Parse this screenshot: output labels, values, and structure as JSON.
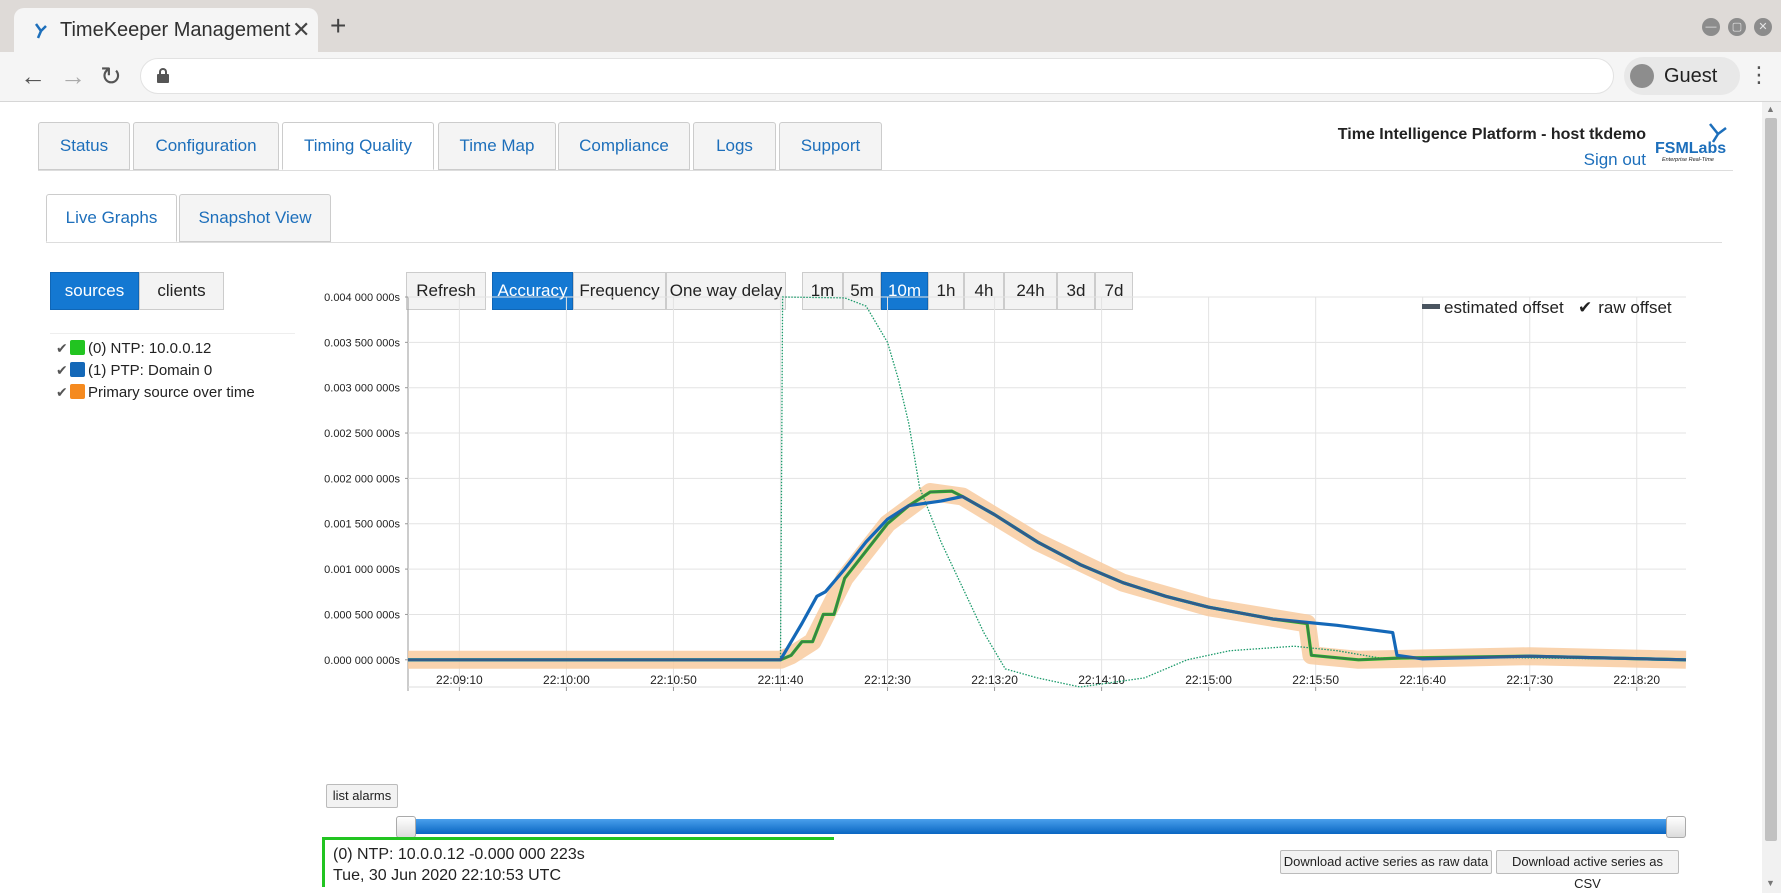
{
  "browser": {
    "tab_title": "TimeKeeper Management",
    "tab_close": "✕",
    "new_tab": "+",
    "profile_label": "Guest"
  },
  "header": {
    "platform_title": "Time Intelligence Platform - host tkdemo",
    "sign_out": "Sign out",
    "logo_text": "FSMLabs",
    "logo_tagline": "Enterprise Real-Time"
  },
  "main_tabs": [
    {
      "label": "Status"
    },
    {
      "label": "Configuration"
    },
    {
      "label": "Timing Quality",
      "active": true
    },
    {
      "label": "Time Map"
    },
    {
      "label": "Compliance"
    },
    {
      "label": "Logs"
    },
    {
      "label": "Support"
    }
  ],
  "sub_tabs": [
    {
      "label": "Live Graphs",
      "active": true
    },
    {
      "label": "Snapshot View"
    }
  ],
  "view_toggle": {
    "sources": "sources",
    "clients": "clients",
    "selected": "sources"
  },
  "controls": {
    "refresh": "Refresh",
    "metrics": [
      "Accuracy",
      "Frequency",
      "One way delay"
    ],
    "selected_metric": "Accuracy",
    "ranges": [
      "1m",
      "5m",
      "10m",
      "1h",
      "4h",
      "24h",
      "3d",
      "7d"
    ],
    "selected_range": "10m"
  },
  "sources_legend": [
    {
      "label": "(0) NTP: 10.0.0.12",
      "color": "#22c421",
      "checked": true
    },
    {
      "label": "(1) PTP: Domain 0",
      "color": "#1468b8",
      "checked": true
    },
    {
      "label": "Primary source over time",
      "color": "#f58a1f",
      "checked": true
    }
  ],
  "series_legend": {
    "estimated": "estimated offset",
    "raw": "raw offset"
  },
  "chart_data": {
    "type": "line",
    "title": "",
    "xlabel": "",
    "ylabel": "",
    "x_ticks": [
      "22:09:10",
      "22:10:00",
      "22:10:50",
      "22:11:40",
      "22:12:30",
      "22:13:20",
      "22:14:10",
      "22:15:00",
      "22:15:50",
      "22:16:40",
      "22:17:30",
      "22:18:20"
    ],
    "y_ticks": [
      "0.000 000 000s",
      "0.000 500 000s",
      "0.001 000 000s",
      "0.001 500 000s",
      "0.002 000 000s",
      "0.002 500 000s",
      "0.003 000 000s",
      "0.003 500 000s",
      "0.004 000 000s"
    ],
    "xlim": [
      "22:08:46",
      "22:18:43"
    ],
    "ylim": [
      -0.0003,
      0.004
    ],
    "grid": true,
    "legend": "top-right",
    "series": [
      {
        "name": "(0) NTP: 10.0.0.12 estimated offset",
        "color": "#22c421",
        "style": "thick",
        "points": [
          [
            "22:08:46",
            0.0
          ],
          [
            "22:11:40",
            0.0
          ],
          [
            "22:11:45",
            5e-05
          ],
          [
            "22:11:50",
            0.0002
          ],
          [
            "22:11:55",
            0.0002
          ],
          [
            "22:12:00",
            0.0005
          ],
          [
            "22:12:05",
            0.0005
          ],
          [
            "22:12:10",
            0.0009
          ],
          [
            "22:12:20",
            0.0012
          ],
          [
            "22:12:30",
            0.0015
          ],
          [
            "22:12:40",
            0.0017
          ],
          [
            "22:12:50",
            0.00185
          ],
          [
            "22:13:00",
            0.00186
          ],
          [
            "22:13:05",
            0.0018
          ],
          [
            "22:13:20",
            0.0016
          ],
          [
            "22:13:40",
            0.0013
          ],
          [
            "22:14:00",
            0.00105
          ],
          [
            "22:14:20",
            0.00085
          ],
          [
            "22:14:40",
            0.0007
          ],
          [
            "22:15:00",
            0.00058
          ],
          [
            "22:15:30",
            0.00045
          ],
          [
            "22:15:46",
            0.0004
          ],
          [
            "22:15:48",
            5e-05
          ],
          [
            "22:16:10",
            0.0
          ],
          [
            "22:16:30",
            2e-05
          ],
          [
            "22:17:30",
            4e-05
          ],
          [
            "22:18:43",
            0.0
          ]
        ]
      },
      {
        "name": "(1) PTP: Domain 0 estimated offset",
        "color": "#1468b8",
        "style": "thick",
        "points": [
          [
            "22:08:46",
            0.0
          ],
          [
            "22:11:40",
            0.0
          ],
          [
            "22:11:50",
            0.0004
          ],
          [
            "22:11:57",
            0.0007
          ],
          [
            "22:12:01",
            0.00075
          ],
          [
            "22:12:10",
            0.001
          ],
          [
            "22:12:20",
            0.0013
          ],
          [
            "22:12:30",
            0.00155
          ],
          [
            "22:12:40",
            0.0017
          ],
          [
            "22:12:55",
            0.00175
          ],
          [
            "22:13:05",
            0.0018
          ],
          [
            "22:13:20",
            0.0016
          ],
          [
            "22:13:40",
            0.0013
          ],
          [
            "22:14:00",
            0.00105
          ],
          [
            "22:14:20",
            0.00085
          ],
          [
            "22:14:40",
            0.0007
          ],
          [
            "22:15:00",
            0.00058
          ],
          [
            "22:15:30",
            0.00045
          ],
          [
            "22:16:00",
            0.00038
          ],
          [
            "22:16:26",
            0.0003
          ],
          [
            "22:16:28",
            5e-05
          ],
          [
            "22:16:40",
            1e-05
          ],
          [
            "22:17:30",
            4e-05
          ],
          [
            "22:18:43",
            0.0
          ]
        ]
      },
      {
        "name": "raw offset",
        "color": "#1a9a6a",
        "style": "dotted",
        "points": [
          [
            "22:08:46",
            0.0
          ],
          [
            "22:11:40",
            0.0
          ],
          [
            "22:11:41",
            0.004
          ],
          [
            "22:12:10",
            0.00399
          ],
          [
            "22:12:20",
            0.0039
          ],
          [
            "22:12:30",
            0.0035
          ],
          [
            "22:12:35",
            0.0031
          ],
          [
            "22:12:40",
            0.0026
          ],
          [
            "22:12:45",
            0.0019
          ],
          [
            "22:12:55",
            0.0013
          ],
          [
            "22:13:05",
            0.0008
          ],
          [
            "22:13:15",
            0.0003
          ],
          [
            "22:13:25",
            -0.0001
          ],
          [
            "22:13:40",
            -0.0002
          ],
          [
            "22:14:00",
            -0.0003
          ],
          [
            "22:14:30",
            -0.0002
          ],
          [
            "22:14:50",
            0.0
          ],
          [
            "22:15:10",
            0.0001
          ],
          [
            "22:15:40",
            0.00015
          ],
          [
            "22:16:00",
            0.0001
          ],
          [
            "22:16:20",
            2e-05
          ],
          [
            "22:17:00",
            3e-05
          ],
          [
            "22:18:43",
            0.0
          ]
        ]
      },
      {
        "name": "Primary source over time",
        "color": "#f8cba0",
        "style": "band",
        "points": [
          [
            "22:08:46",
            0.0
          ],
          [
            "22:11:40",
            0.0
          ],
          [
            "22:11:45",
            5e-05
          ],
          [
            "22:11:55",
            0.0002
          ],
          [
            "22:12:10",
            0.0009
          ],
          [
            "22:12:30",
            0.0015
          ],
          [
            "22:12:50",
            0.00185
          ],
          [
            "22:13:05",
            0.0018
          ],
          [
            "22:13:40",
            0.0013
          ],
          [
            "22:14:20",
            0.00085
          ],
          [
            "22:15:00",
            0.00058
          ],
          [
            "22:15:46",
            0.0004
          ],
          [
            "22:15:48",
            5e-05
          ],
          [
            "22:16:10",
            0.0
          ],
          [
            "22:17:30",
            4e-05
          ],
          [
            "22:18:43",
            0.0
          ]
        ]
      }
    ]
  },
  "actions": {
    "list_alarms": "list alarms",
    "download_raw": "Download active series as raw data",
    "download_csv": "Download active series as CSV"
  },
  "tooltip": {
    "line1": "(0) NTP: 10.0.0.12 -0.000 000 223s",
    "line2": "Tue, 30 Jun 2020 22:10:53 UTC"
  }
}
